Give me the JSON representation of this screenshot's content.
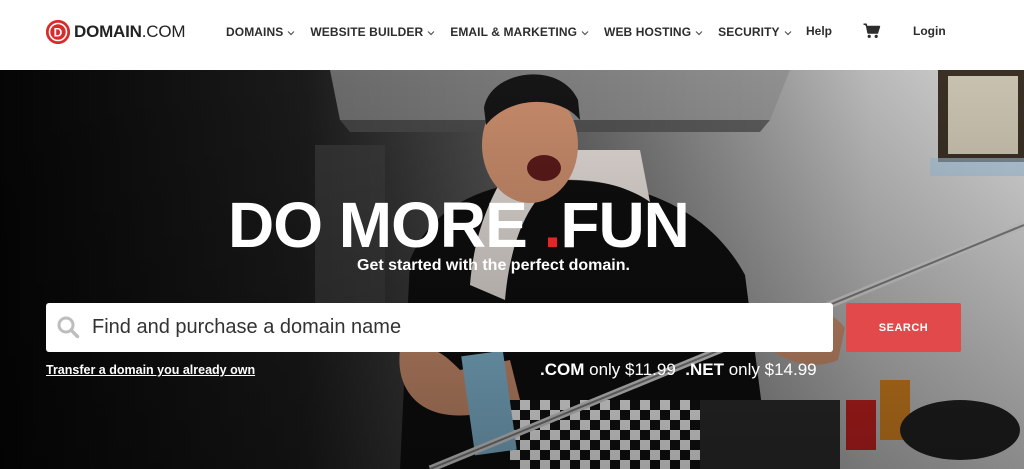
{
  "header": {
    "logo": {
      "mark": "D",
      "brand_bold": "DOMAIN",
      "brand_suffix": ".COM"
    },
    "nav": [
      {
        "label": "DOMAINS"
      },
      {
        "label": "WEBSITE BUILDER"
      },
      {
        "label": "EMAIL & MARKETING"
      },
      {
        "label": "WEB HOSTING"
      },
      {
        "label": "SECURITY"
      }
    ],
    "help_label": "Help",
    "cart_icon": "shopping-cart-icon",
    "login_label": "Login"
  },
  "hero": {
    "headline_part1": "DO MORE",
    "headline_dot": ".",
    "headline_part2": "FUN",
    "subheadline": "Get started with the perfect domain.",
    "search": {
      "icon": "search-icon",
      "placeholder": "Find and purchase a domain name",
      "value": "",
      "button_label": "SEARCH"
    },
    "transfer_link": "Transfer a domain you already own",
    "pricing": {
      "com_tld": ".COM",
      "com_text": "only $11.99",
      "net_tld": ".NET",
      "net_text": "only $14.99"
    }
  },
  "colors": {
    "brand_red": "#d92b2b",
    "search_button": "#e2494b",
    "nav_text": "#2d2d2d",
    "hero_text": "#ffffff"
  }
}
